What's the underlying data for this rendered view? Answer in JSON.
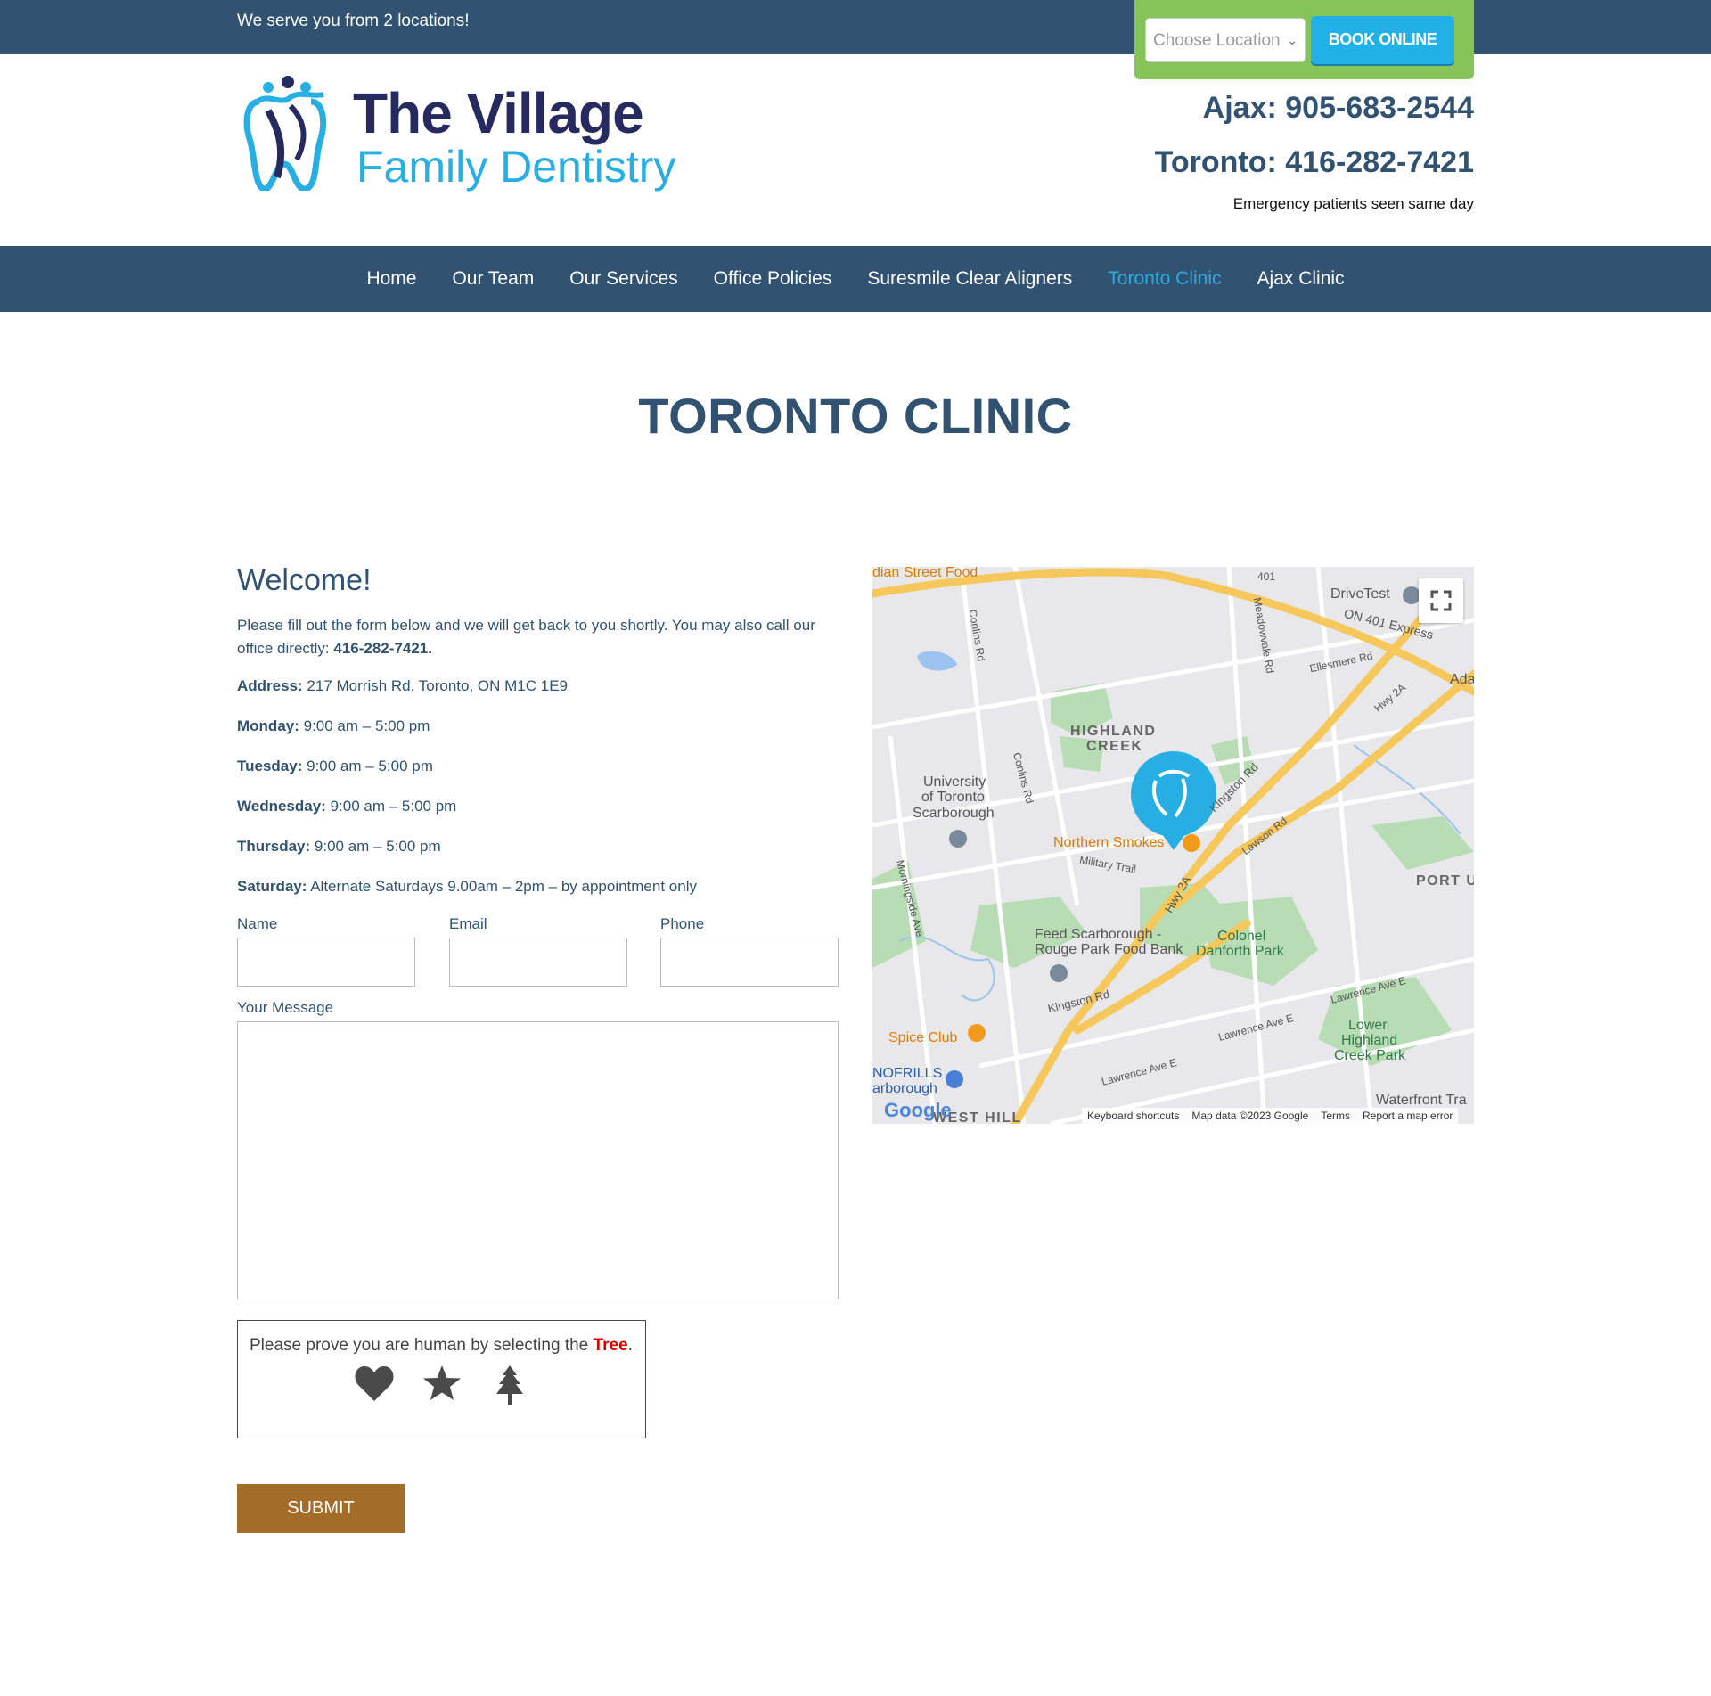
{
  "topbar": {
    "serve_text": "We serve you from 2 locations!",
    "location_select": "Choose Location",
    "book_button": "BOOK ONLINE"
  },
  "header": {
    "logo_title": "The Village",
    "logo_subtitle": "Family Dentistry",
    "phone_ajax": "Ajax: 905-683-2544",
    "phone_toronto": "Toronto: 416-282-7421",
    "emergency": "Emergency patients seen same day"
  },
  "nav": {
    "items": [
      {
        "label": "Home"
      },
      {
        "label": "Our Team"
      },
      {
        "label": "Our Services"
      },
      {
        "label": "Office Policies"
      },
      {
        "label": "Suresmile Clear Aligners"
      },
      {
        "label": "Toronto Clinic",
        "active": true
      },
      {
        "label": "Ajax Clinic"
      }
    ]
  },
  "page": {
    "title": "TORONTO CLINIC",
    "welcome": "Welcome!",
    "intro": "Please fill out the form below and we will get back to you shortly. You may also call our office directly:",
    "intro_phone": "416-282-7421.",
    "address_label": "Address:",
    "address_value": "217 Morrish Rd, Toronto, ON M1C 1E9",
    "hours": [
      {
        "day": "Monday:",
        "time": "9:00 am – 5:00 pm"
      },
      {
        "day": "Tuesday:",
        "time": "9:00 am – 5:00 pm"
      },
      {
        "day": "Wednesday:",
        "time": "9:00 am – 5:00 pm"
      },
      {
        "day": "Thursday:",
        "time": "9:00 am – 5:00 pm"
      },
      {
        "day": "Saturday:",
        "time": "Alternate Saturdays 9.00am – 2pm – by appointment only"
      }
    ]
  },
  "form": {
    "name_label": "Name",
    "email_label": "Email",
    "phone_label": "Phone",
    "message_label": "Your Message",
    "name_value": "",
    "email_value": "",
    "phone_value": "",
    "message_value": "",
    "captcha_prefix": "Please prove you are human by selecting the",
    "captcha_target": "Tree",
    "captcha_suffix": ".",
    "captcha_icons": [
      "heart-icon",
      "star-icon",
      "tree-icon"
    ],
    "submit": "SUBMIT"
  },
  "map": {
    "labels": {
      "indian_food": "dian Street Food",
      "hwy401": "401",
      "drivetest": "DriveTest",
      "on401": "ON 401 Express",
      "ada": "Ada",
      "conlins1": "Conlins Rd",
      "meadowvale": "Meadowvale Rd",
      "ellesmere": "Ellesmere Rd",
      "hwy2a": "Hwy 2A",
      "highland": "HIGHLAND",
      "creek": "CREEK",
      "uoft1": "University",
      "uoft2": "of Toronto",
      "uoft3": "Scarborough",
      "conlins2": "Conlins Rd",
      "kingston1": "Kingston Rd",
      "lawson": "Lawson Rd",
      "northern": "Northern Smokes",
      "military": "Military Trail",
      "portu": "PORT U",
      "morningside": "Morningside Ave",
      "hwy2a2": "Hwy 2A",
      "feed1": "Feed Scarborough -",
      "feed2": "Rouge Park Food Bank",
      "colonel1": "Colonel",
      "colonel2": "Danforth Park",
      "kingston2": "Kingston Rd",
      "lawrence1": "Lawrence Ave E",
      "lawrence2": "Lawrence Ave E",
      "lawrence3": "Lawrence Ave E",
      "spice": "Spice Club",
      "lower1": "Lower",
      "lower2": "Highland",
      "lower3": "Creek Park",
      "nofrills1": "NOFRILLS",
      "nofrills2": "arborough",
      "westhill": "WEST HILL",
      "waterfront": "Waterfront Tra",
      "google": "Google"
    },
    "attribution": {
      "shortcuts": "Keyboard shortcuts",
      "data": "Map data ©2023 Google",
      "terms": "Terms",
      "report": "Report a map error"
    },
    "colors": {
      "land": "#e8e8ea",
      "highway": "#f6c75a",
      "park": "#a8d8a8",
      "water": "#9cc3f0",
      "pin": "#27aee3"
    }
  },
  "colors": {
    "topbar": "#315270",
    "book_box": "#86c45a",
    "book_button": "#22b1e6",
    "nav_active": "#27aee3",
    "submit": "#a36c28",
    "captcha_highlight": "#e00000"
  }
}
